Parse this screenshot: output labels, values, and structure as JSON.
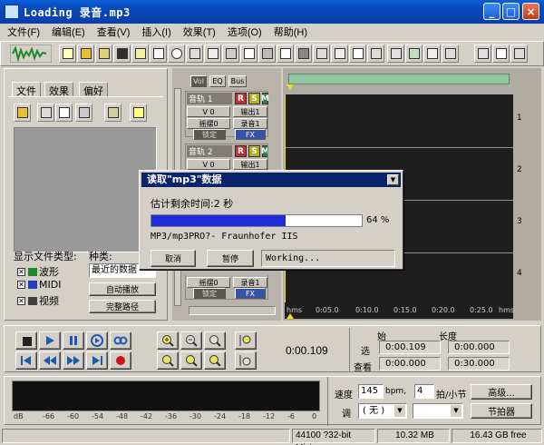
{
  "window": {
    "title": "Loading 录音.mp3",
    "controls": [
      "_",
      "□",
      "×"
    ]
  },
  "menu": [
    "文件(F)",
    "编辑(E)",
    "查看(V)",
    "插入(I)",
    "效果(T)",
    "选项(O)",
    "帮助(H)"
  ],
  "left_panel": {
    "tabs": [
      "文件",
      "效果",
      "偏好"
    ],
    "file_type_label": "显示文件类型:",
    "kind_label": "种类:",
    "file_types": [
      {
        "label": "波形",
        "checked": true
      },
      {
        "label": "MIDI",
        "checked": true
      },
      {
        "label": "视频",
        "checked": true
      }
    ],
    "kind_value": "最近的数据",
    "auto_play_label": "自动播放",
    "full_path_label": "完整路径"
  },
  "tracks": {
    "tabs": [
      "Vol",
      "EQ",
      "Bus"
    ],
    "items": [
      {
        "name": "音轨 1",
        "vol": "V 0",
        "out": "输出1",
        "pan": "摇摆0",
        "rec": "录音1",
        "lock": "锁定",
        "fx": "FX"
      },
      {
        "name": "音轨 2",
        "vol": "V 0",
        "out": "输出1",
        "pan": "摇摆0",
        "rec": "录音1",
        "lock": "锁定",
        "fx": "FX"
      },
      {
        "name": "",
        "vol": "",
        "out": "",
        "pan": "摇摆0",
        "rec": "录音1",
        "lock": "锁定",
        "fx": "FX"
      }
    ],
    "rsm": [
      "R",
      "S",
      "M"
    ]
  },
  "timeline": {
    "track_numbers": [
      "1",
      "2",
      "3",
      "4"
    ],
    "ruler": [
      "hms",
      "0:05.0",
      "0:10.0",
      "0:15.0",
      "0:20.0",
      "0:25.0",
      "hms"
    ]
  },
  "transport": {
    "time_display": "0:00.109",
    "start_label": "始",
    "length_label": "长度",
    "select_label": "选",
    "view_label": "查看",
    "select_start": "0:00.109",
    "select_length": "0:00.000",
    "view_start": "0:00.000",
    "view_length": "0:30.000"
  },
  "meter": {
    "scale": [
      "dB",
      "-66",
      "-60",
      "-54",
      "-48",
      "-42",
      "-36",
      "-30",
      "-24",
      "-18",
      "-12",
      "-6",
      "0"
    ]
  },
  "tempo": {
    "speed_label": "速度",
    "bpm": "145",
    "bpm_unit": "bpm,",
    "beats": "4",
    "beats_unit": "拍/小节",
    "advanced_label": "高级...",
    "key_label": "调",
    "key_value": "( 无 )",
    "metronome_label": "节拍器"
  },
  "status": {
    "format": "44100 ?32-bit Mixing",
    "size": "10.32 MB",
    "free": "16.43 GB free"
  },
  "dialog": {
    "title": "读取\"mp3\"数据",
    "remaining": "估计剩余时间:2 秒",
    "percent_value": 0.64,
    "percent_text": "64 %",
    "codec": "MP3/mp3PRO?- Fraunhofer IIS",
    "cancel_label": "取消",
    "pause_label": "暂停",
    "status_text": "Working..."
  },
  "colors": {
    "titlebar": "#0a5fd8",
    "dialog_title": "#0a246a",
    "progress": "#1c2cd8",
    "rec": "#c03030",
    "solo": "#b0b020",
    "mute": "#308040",
    "track_blue": "#3553a8"
  }
}
